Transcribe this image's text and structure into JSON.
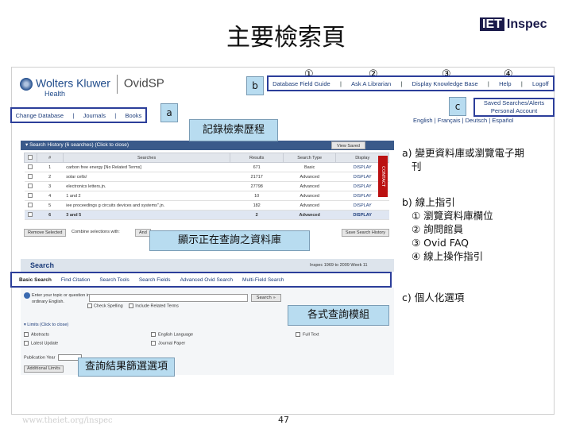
{
  "slide": {
    "title": "主要檢索頁",
    "brand": {
      "iet": "IET",
      "name": "Inspec"
    },
    "footer_url": "www.theiet.org/inspec",
    "page_number": "47"
  },
  "ovid": {
    "logo": "Wolters Kluwer",
    "product": "OvidSP",
    "health": "Health",
    "top_nav": [
      "Database Field Guide",
      "Ask A Librarian",
      "Display Knowledge Base",
      "Help",
      "Logoff"
    ],
    "secondary_nav": [
      "Change Database",
      "Journals",
      "Books"
    ],
    "saved_links": [
      "Saved Searches/Alerts",
      "Personal Account"
    ],
    "languages": [
      "English",
      "Français",
      "Deutsch",
      "Español"
    ]
  },
  "markers": {
    "nums": [
      "①",
      "②",
      "③",
      "④"
    ],
    "a": "a",
    "b": "b",
    "c": "c"
  },
  "callouts": {
    "history": "記錄檢索歷程",
    "database": "顯示正在查詢之資料庫",
    "search_modes": "各式查詢模組",
    "limits": "查詢結果篩選選項"
  },
  "search_history": {
    "header": "Search History",
    "header_note": "(6 searches) (Click to close)",
    "view_saved": "View Saved",
    "side_tab": "CONTACT",
    "columns": [
      "#",
      "Searches",
      "Results",
      "Search Type",
      "Display"
    ],
    "rows": [
      {
        "n": "1",
        "search": "carbon free energy [No Related Terms]",
        "results": "671",
        "type": "Basic",
        "display": "DISPLAY",
        "highlight": false
      },
      {
        "n": "2",
        "search": "solar cells/",
        "results": "21717",
        "type": "Advanced",
        "display": "DISPLAY",
        "highlight": false
      },
      {
        "n": "3",
        "search": "electronics letters.jn.",
        "results": "27798",
        "type": "Advanced",
        "display": "DISPLAY",
        "highlight": false
      },
      {
        "n": "4",
        "search": "1 and 2",
        "results": "10",
        "type": "Advanced",
        "display": "DISPLAY",
        "highlight": false
      },
      {
        "n": "5",
        "search": "iee proceedings g circuits devices and systems\".jn.",
        "results": "182",
        "type": "Advanced",
        "display": "DISPLAY",
        "highlight": false
      },
      {
        "n": "6",
        "search": "3 and 5",
        "results": "2",
        "type": "Advanced",
        "display": "DISPLAY",
        "highlight": true
      }
    ],
    "remove_selected": "Remove Selected",
    "combine_label": "Combine selections with:",
    "combine_value": "And",
    "save_history": "Save Search History"
  },
  "search": {
    "header": "Search",
    "coverage": "Inspec 1969 to 2009 Week 11",
    "tabs": [
      "Basic Search",
      "Find Citation",
      "Search Tools",
      "Search Fields",
      "Advanced Ovid Search",
      "Multi-Field Search"
    ],
    "prompt": "Enter your topic or question in ordinary English.",
    "button": "Search »",
    "opt_spelling": "Check Spelling",
    "opt_related": "Include Related Terms",
    "limits_header": "Limits (Click to close)",
    "limits": [
      "Abstracts",
      "Latest Update",
      "English Language",
      "Journal Paper",
      "Full Text"
    ],
    "pub_year": "Publication Year",
    "additional_limits": "Additional Limits"
  },
  "notes": {
    "a": "a) 變更資料庫或瀏覽電子期",
    "a2": "刊",
    "b": "b) 線上指引",
    "b_items": [
      "① 瀏覽資料庫欄位",
      "② 詢問館員",
      "③ Ovid FAQ",
      "④ 線上操作指引"
    ],
    "c": "c) 個人化選項"
  }
}
